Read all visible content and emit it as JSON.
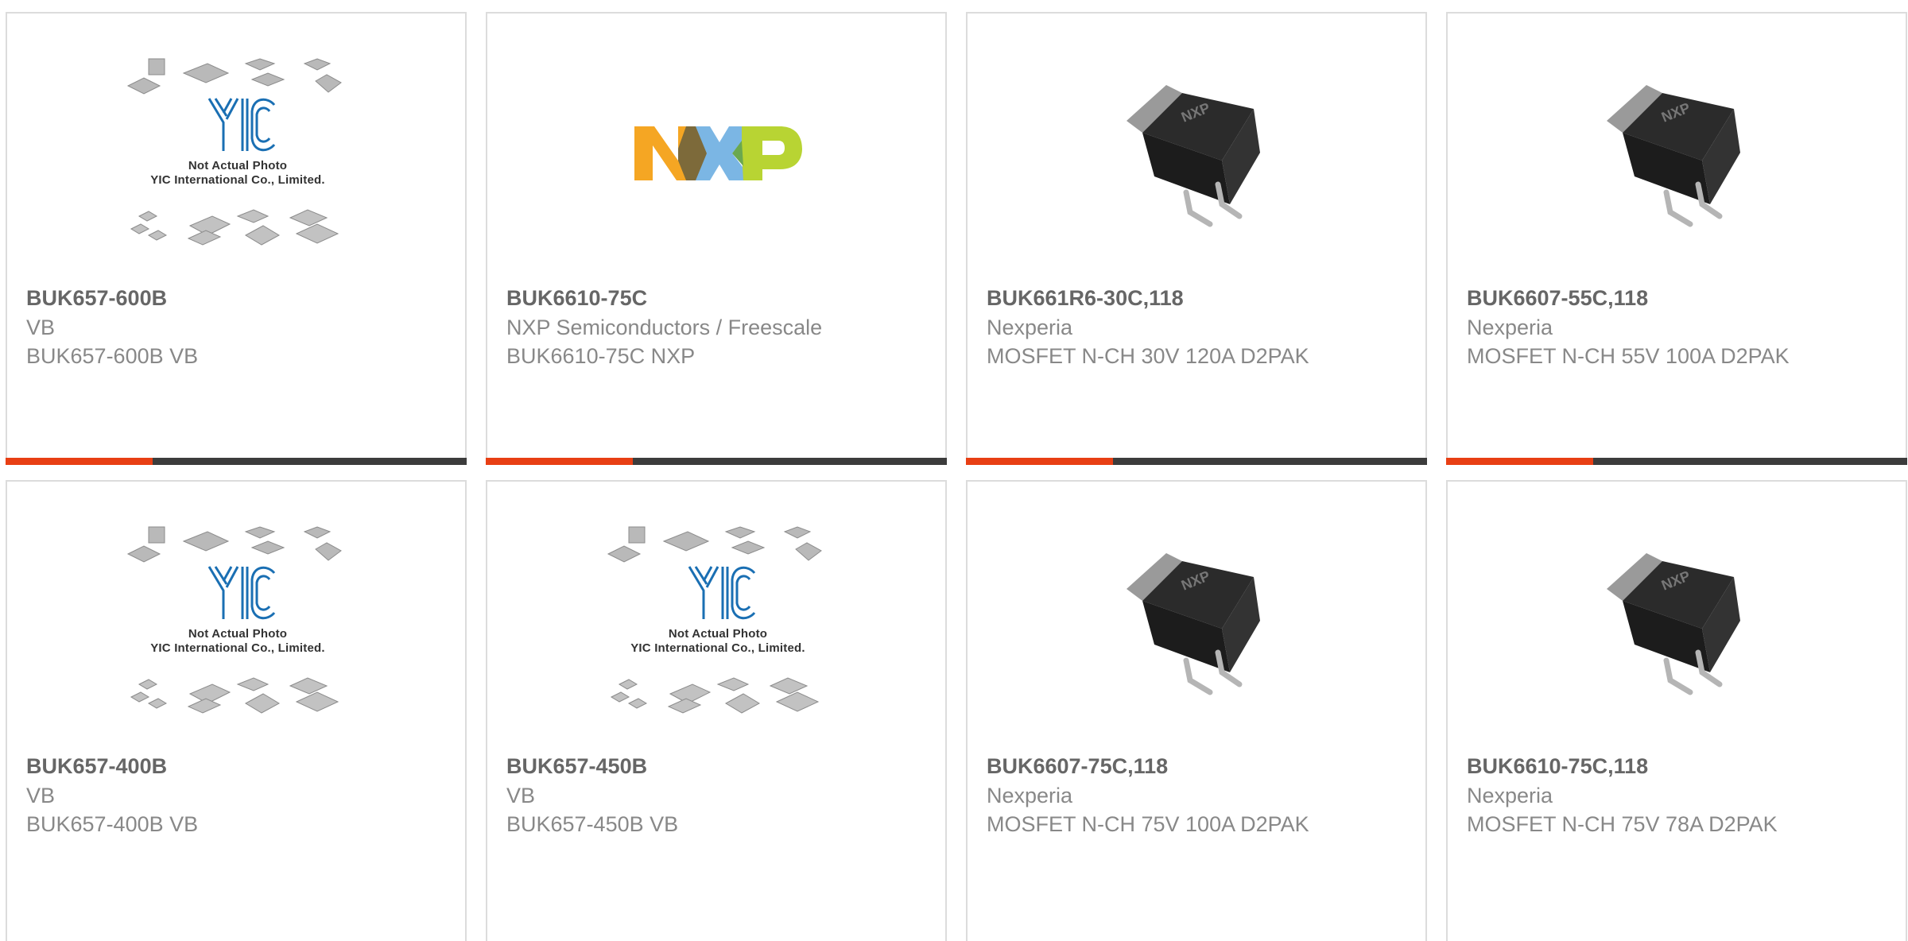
{
  "colors": {
    "accent": "#e83f14",
    "bar": "#3c3c3c",
    "border": "#dcdcdc"
  },
  "placeholder": {
    "line1": "Not Actual Photo",
    "line2": "YIC International Co., Limited."
  },
  "nxp_logo": {
    "letters": [
      "N",
      "X",
      "P"
    ]
  },
  "products": [
    {
      "pn": "BUK657-600B",
      "manufacturer": "VB",
      "description": "BUK657-600B VB",
      "image": "yic-placeholder-icon"
    },
    {
      "pn": "BUK6610-75C",
      "manufacturer": "NXP Semiconductors / Freescale",
      "description": "BUK6610-75C NXP",
      "image": "nxp-logo"
    },
    {
      "pn": "BUK661R6-30C,118",
      "manufacturer": "Nexperia",
      "description": "MOSFET N-CH 30V 120A D2PAK",
      "image": "mosfet-d2pak-icon"
    },
    {
      "pn": "BUK6607-55C,118",
      "manufacturer": "Nexperia",
      "description": "MOSFET N-CH 55V 100A D2PAK",
      "image": "mosfet-d2pak-icon"
    },
    {
      "pn": "BUK657-400B",
      "manufacturer": "VB",
      "description": "BUK657-400B VB",
      "image": "yic-placeholder-icon"
    },
    {
      "pn": "BUK657-450B",
      "manufacturer": "VB",
      "description": "BUK657-450B VB",
      "image": "yic-placeholder-icon"
    },
    {
      "pn": "BUK6607-75C,118",
      "manufacturer": "Nexperia",
      "description": "MOSFET N-CH 75V 100A D2PAK",
      "image": "mosfet-d2pak-icon"
    },
    {
      "pn": "BUK6610-75C,118",
      "manufacturer": "Nexperia",
      "description": "MOSFET N-CH 75V 78A D2PAK",
      "image": "mosfet-d2pak-icon"
    }
  ]
}
